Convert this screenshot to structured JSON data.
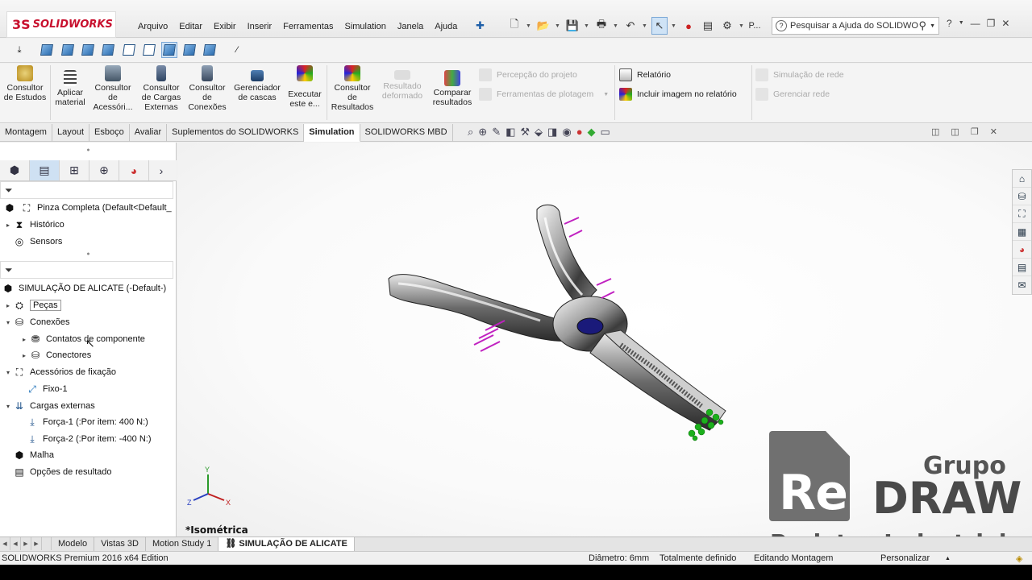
{
  "app": {
    "logo_ds": "3S",
    "logo_name": "SOLIDWORKS"
  },
  "menu": [
    "Arquivo",
    "Editar",
    "Exibir",
    "Inserir",
    "Ferramentas",
    "Simulation",
    "Janela",
    "Ajuda"
  ],
  "search": {
    "placeholder": "Pesquisar a Ajuda do SOLIDWO",
    "overflow_label": "P..."
  },
  "command_manager": {
    "buttons": [
      {
        "label": "Consultor de Estudos",
        "disabled": false
      },
      {
        "label": "Aplicar material",
        "disabled": false
      },
      {
        "label": "Consultor de Acessóri...",
        "disabled": false
      },
      {
        "label": "Consultor de Cargas Externas",
        "disabled": false
      },
      {
        "label": "Consultor de Conexões",
        "disabled": false
      },
      {
        "label": "Gerenciador de cascas",
        "disabled": false
      },
      {
        "label": "Executar este e...",
        "disabled": false
      },
      {
        "label": "Consultor de Resultados",
        "disabled": false
      },
      {
        "label": "Resultado deformado",
        "disabled": true
      },
      {
        "label": "Comparar resultados",
        "disabled": false
      }
    ],
    "small_items": {
      "percepcao": "Percepção do projeto",
      "ferramentas_plotagem": "Ferramentas de plotagem",
      "relatorio": "Relatório",
      "incluir_imagem": "Incluir imagem no relatório",
      "simulacao_rede": "Simulação de rede",
      "gerenciar_rede": "Gerenciar rede"
    }
  },
  "tabs": [
    "Montagem",
    "Layout",
    "Esboço",
    "Avaliar",
    "Suplementos do SOLIDWORKS",
    "Simulation",
    "SOLIDWORKS MBD"
  ],
  "active_tab": "Simulation",
  "feature_tree": {
    "root": "Pinza Completa  (Default<Default_",
    "items": [
      "Histórico",
      "Sensors"
    ]
  },
  "study_tree": {
    "root": "SIMULAÇÃO DE ALICATE (-Default-)",
    "items": [
      {
        "label": "Peças",
        "level": 1
      },
      {
        "label": "Conexões",
        "level": 1
      },
      {
        "label": "Contatos de componente",
        "level": 2
      },
      {
        "label": "Conectores",
        "level": 2
      },
      {
        "label": "Acessórios de fixação",
        "level": 1
      },
      {
        "label": "Fixo-1",
        "level": 2
      },
      {
        "label": "Cargas externas",
        "level": 1
      },
      {
        "label": "Força-1 (:Por item: 400 N:)",
        "level": 2
      },
      {
        "label": "Força-2 (:Por item: -400 N:)",
        "level": 2
      },
      {
        "label": "Malha",
        "level": 1
      },
      {
        "label": "Opções de resultado",
        "level": 1
      }
    ]
  },
  "viewport": {
    "view_name": "*Isométrica",
    "axis_x": "X",
    "axis_y": "Y",
    "axis_z": "Z"
  },
  "watermark": {
    "grupo": "Grupo",
    "re": "Re",
    "draw": "DRAW",
    "projetos": "Projetos Industriais"
  },
  "bottom_tabs": [
    "Modelo",
    "Vistas 3D",
    "Motion Study 1",
    "SIMULAÇÃO DE ALICATE"
  ],
  "active_bottom_tab": "SIMULAÇÃO DE ALICATE",
  "status": {
    "edition": "SOLIDWORKS Premium 2016 x64 Edition",
    "diameter": "Diâmetro: 6mm",
    "defined": "Totalmente definido",
    "editing": "Editando Montagem",
    "customize": "Personalizar"
  }
}
